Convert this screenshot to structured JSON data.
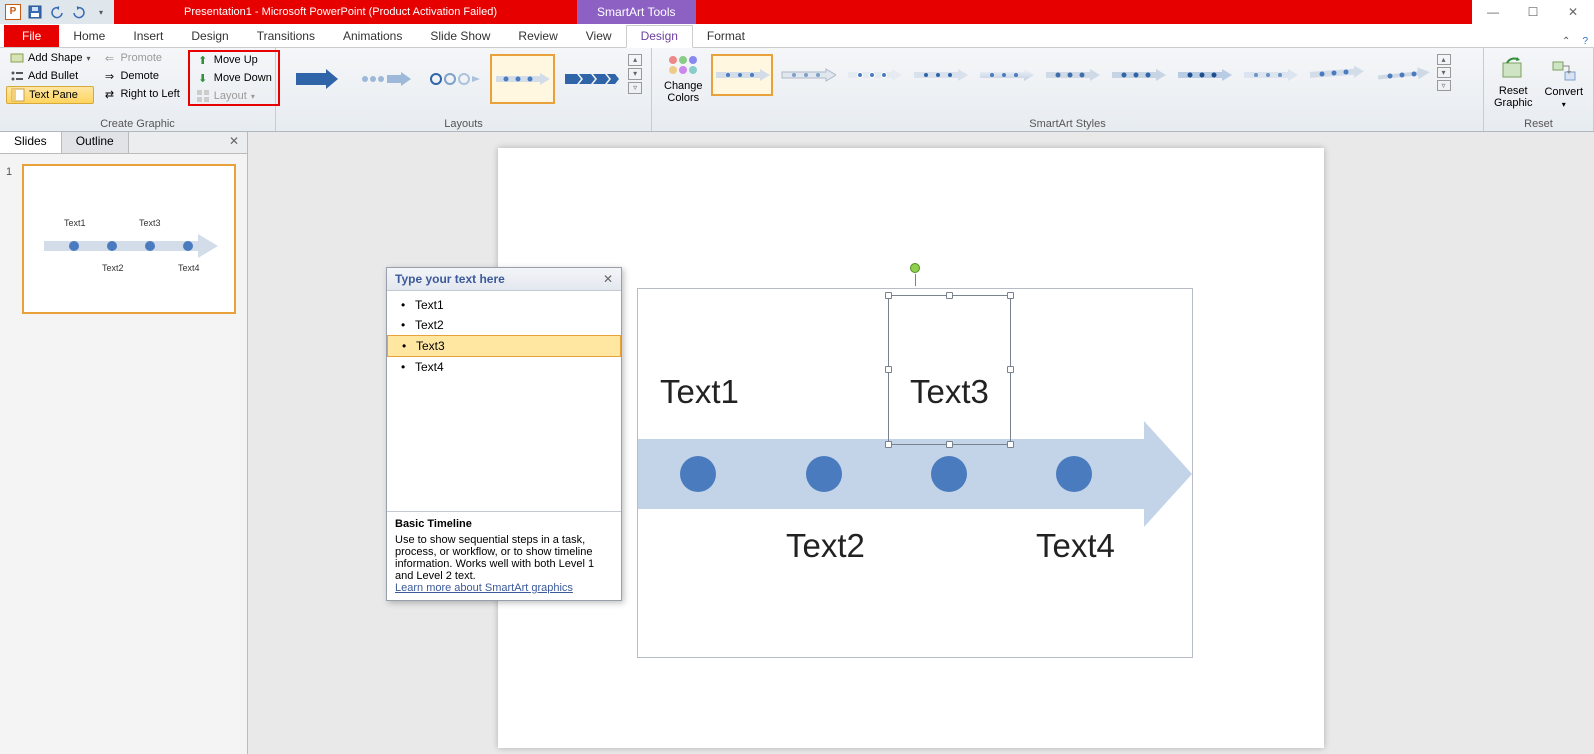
{
  "title": "Presentation1 - Microsoft PowerPoint (Product Activation Failed)",
  "contextual_tab": "SmartArt Tools",
  "tabs": {
    "file": "File",
    "home": "Home",
    "insert": "Insert",
    "design": "Design",
    "transitions": "Transitions",
    "animations": "Animations",
    "slideshow": "Slide Show",
    "review": "Review",
    "view": "View",
    "sa_design": "Design",
    "sa_format": "Format"
  },
  "ribbon": {
    "create_graphic": {
      "add_shape": "Add Shape",
      "add_bullet": "Add Bullet",
      "text_pane": "Text Pane",
      "promote": "Promote",
      "demote": "Demote",
      "right_to_left": "Right to Left",
      "move_up": "Move Up",
      "move_down": "Move Down",
      "layout": "Layout",
      "label": "Create Graphic"
    },
    "layouts": {
      "label": "Layouts"
    },
    "change_colors": "Change\nColors",
    "styles": {
      "label": "SmartArt Styles"
    },
    "reset": {
      "reset_graphic": "Reset\nGraphic",
      "convert": "Convert",
      "label": "Reset"
    }
  },
  "slides_pane": {
    "slides": "Slides",
    "outline": "Outline",
    "num": "1"
  },
  "text_pane": {
    "title": "Type your text here",
    "items": [
      "Text1",
      "Text2",
      "Text3",
      "Text4"
    ],
    "selected_index": 2,
    "footer_title": "Basic Timeline",
    "footer_desc": "Use to show sequential steps in a task, process, or workflow, or to show timeline information. Works well with both Level 1 and Level 2 text.",
    "footer_link": "Learn more about SmartArt graphics"
  },
  "smartart": {
    "text1": "Text1",
    "text2": "Text2",
    "text3": "Text3",
    "text4": "Text4"
  },
  "thumb": {
    "t1": "Text1",
    "t2": "Text2",
    "t3": "Text3",
    "t4": "Text4"
  }
}
